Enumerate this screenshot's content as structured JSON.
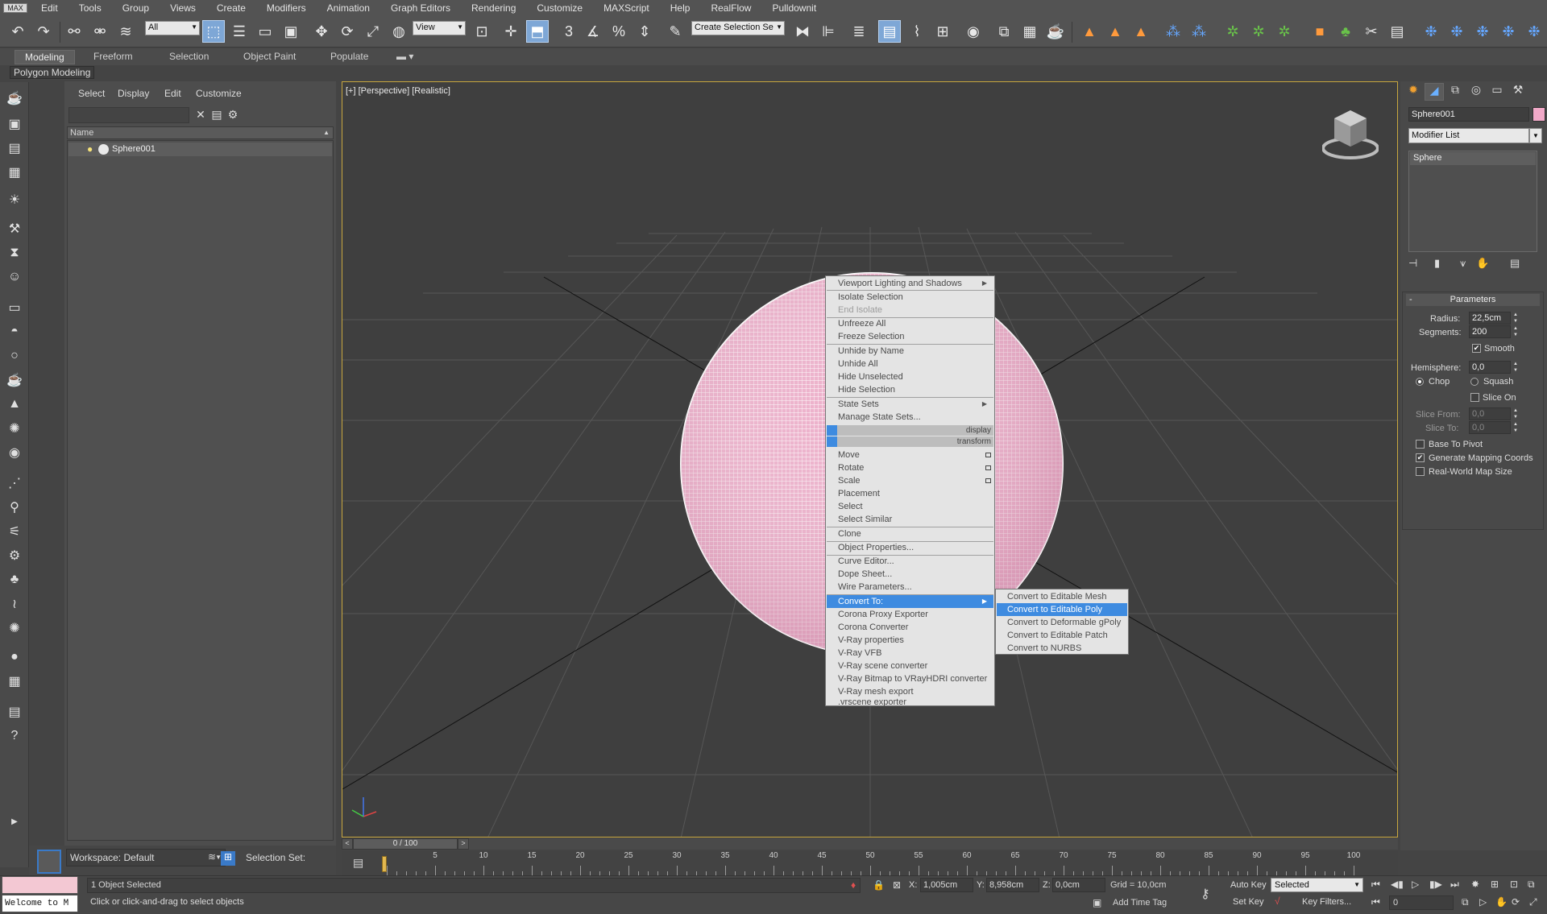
{
  "menubar": {
    "logo": "MAX",
    "items": [
      "Edit",
      "Tools",
      "Group",
      "Views",
      "Create",
      "Modifiers",
      "Animation",
      "Graph Editors",
      "Rendering",
      "Customize",
      "MAXScript",
      "Help",
      "RealFlow",
      "Pulldownit"
    ]
  },
  "toolbar": {
    "filter_value": "All",
    "refcoord_value": "View",
    "selection_set_placeholder": "Create Selection Se"
  },
  "ribbon": {
    "tabs": [
      "Modeling",
      "Freeform",
      "Selection",
      "Object Paint",
      "Populate"
    ],
    "active_tab": "Modeling",
    "panel_label": "Polygon Modeling"
  },
  "explorer": {
    "menus": [
      "Select",
      "Display",
      "Edit",
      "Customize"
    ],
    "column_header": "Name",
    "rows": [
      {
        "name": "Sphere001"
      }
    ]
  },
  "workspace": {
    "label": "Workspace: Default",
    "selection_set_label": "Selection Set:"
  },
  "viewport": {
    "label": "[+] [Perspective] [Realistic]"
  },
  "context_menu": {
    "items": [
      {
        "label": "Viewport Lighting and Shadows",
        "state": "normal",
        "submenu": true
      },
      {
        "label": "Isolate Selection",
        "state": "normal"
      },
      {
        "label": "End Isolate",
        "state": "disabled"
      },
      {
        "label": "Unfreeze All",
        "state": "normal"
      },
      {
        "label": "Freeze Selection",
        "state": "normal"
      },
      {
        "label": "Unhide by Name",
        "state": "normal"
      },
      {
        "label": "Unhide All",
        "state": "normal"
      },
      {
        "label": "Hide Unselected",
        "state": "normal"
      },
      {
        "label": "Hide Selection",
        "state": "normal"
      },
      {
        "label": "State Sets",
        "state": "normal",
        "submenu": true
      },
      {
        "label": "Manage State Sets...",
        "state": "normal"
      },
      {
        "label": "display",
        "state": "header"
      },
      {
        "label": "transform",
        "state": "header"
      },
      {
        "label": "Move",
        "state": "normal",
        "box": true
      },
      {
        "label": "Rotate",
        "state": "normal",
        "box": true
      },
      {
        "label": "Scale",
        "state": "normal",
        "box": true
      },
      {
        "label": "Placement",
        "state": "normal"
      },
      {
        "label": "Select",
        "state": "normal"
      },
      {
        "label": "Select Similar",
        "state": "normal"
      },
      {
        "label": "Clone",
        "state": "normal"
      },
      {
        "label": "Object Properties...",
        "state": "normal"
      },
      {
        "label": "Curve Editor...",
        "state": "normal"
      },
      {
        "label": "Dope Sheet...",
        "state": "normal"
      },
      {
        "label": "Wire Parameters...",
        "state": "normal"
      },
      {
        "label": "Convert To:",
        "state": "highlighted",
        "submenu": true
      },
      {
        "label": "Corona Proxy Exporter",
        "state": "normal"
      },
      {
        "label": "Corona Converter",
        "state": "normal"
      },
      {
        "label": "V-Ray properties",
        "state": "normal"
      },
      {
        "label": "V-Ray VFB",
        "state": "normal"
      },
      {
        "label": "V-Ray scene converter",
        "state": "normal"
      },
      {
        "label": "V-Ray Bitmap to VRayHDRI converter",
        "state": "normal"
      },
      {
        "label": "V-Ray mesh export",
        "state": "normal"
      },
      {
        "label": ".vrscene exporter",
        "state": "normal"
      }
    ]
  },
  "submenu": {
    "items": [
      {
        "label": "Convert to Editable Mesh",
        "state": "normal"
      },
      {
        "label": "Convert to Editable Poly",
        "state": "highlighted"
      },
      {
        "label": "Convert to Deformable gPoly",
        "state": "normal"
      },
      {
        "label": "Convert to Editable Patch",
        "state": "normal"
      },
      {
        "label": "Convert to NURBS",
        "state": "normal"
      }
    ]
  },
  "timeline": {
    "frame_display": "0 / 100",
    "tick_labels": [
      5,
      10,
      15,
      20,
      25,
      30,
      35,
      40,
      45,
      50,
      55,
      60,
      65,
      70,
      75,
      80,
      85,
      90,
      95,
      100
    ],
    "total_frames": 100
  },
  "status": {
    "listener_text": "Welcome to M",
    "selection_info": "1 Object Selected",
    "hint": "Click or click-and-drag to select objects",
    "x_label": "X:",
    "x_value": "1,005cm",
    "y_label": "Y:",
    "y_value": "8,958cm",
    "z_label": "Z:",
    "z_value": "0,0cm",
    "grid": "Grid = 10,0cm",
    "add_time_tag": "Add Time Tag",
    "auto_key": "Auto Key",
    "set_key": "Set Key",
    "key_mode_value": "Selected",
    "key_filters": "Key Filters...",
    "current_frame": "0"
  },
  "command_panel": {
    "object_name": "Sphere001",
    "object_color": "#f1a9c8",
    "modifier_list": "Modifier List",
    "stack_item": "Sphere",
    "rollout_title": "Parameters",
    "radius_label": "Radius:",
    "radius_value": "22,5cm",
    "segments_label": "Segments:",
    "segments_value": "200",
    "smooth_label": "Smooth",
    "smooth_checked": true,
    "hemisphere_label": "Hemisphere:",
    "hemisphere_value": "0,0",
    "chop_label": "Chop",
    "squash_label": "Squash",
    "slice_on_label": "Slice On",
    "slice_from_label": "Slice From:",
    "slice_from_value": "0,0",
    "slice_to_label": "Slice To:",
    "slice_to_value": "0,0",
    "base_to_pivot_label": "Base To Pivot",
    "gen_mapping_label": "Generate Mapping Coords",
    "gen_mapping_checked": true,
    "real_world_label": "Real-World Map Size"
  },
  "colors": {
    "accent": "#3e8be0",
    "viewport_border": "#c8a73e",
    "sphere": "#f0b4ce"
  }
}
